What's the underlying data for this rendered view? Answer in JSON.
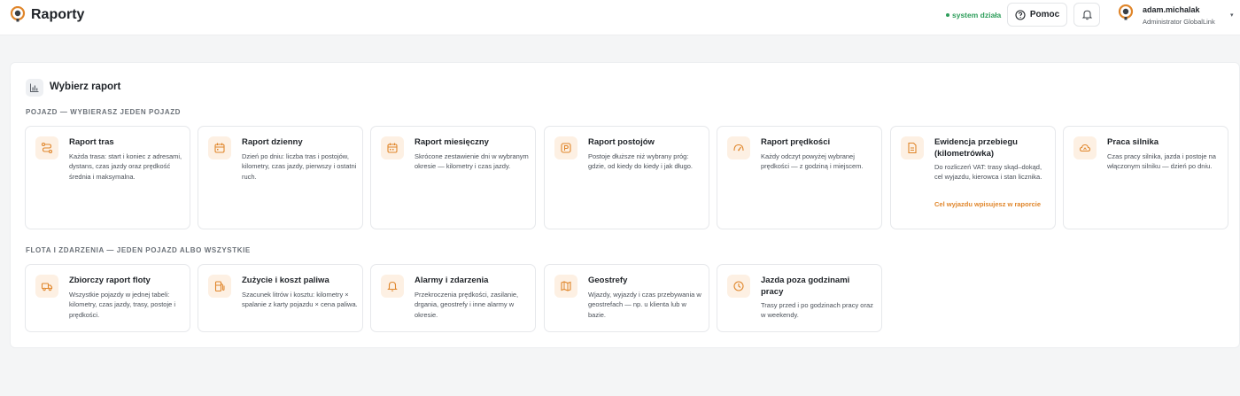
{
  "header": {
    "title": "Raporty",
    "status": "system działa",
    "help_label": "Pomoc",
    "user_name": "adam.michalak",
    "user_role": "Administrator GlobalLink"
  },
  "panel": {
    "title": "Wybierz raport",
    "sections": [
      {
        "label": "POJAZD — WYBIERASZ JEDEN POJAZD",
        "cards": [
          {
            "icon": "route-icon",
            "title": "Raport tras",
            "description": "Każda trasa: start i koniec z adresami, dystans, czas jazdy oraz prędkość średnia i maksymalna."
          },
          {
            "icon": "calendar-icon",
            "title": "Raport dzienny",
            "description": "Dzień po dniu: liczba tras i postojów, kilometry, czas jazdy, pierwszy i ostatni ruch."
          },
          {
            "icon": "calendar-icon",
            "title": "Raport miesięczny",
            "description": "Skrócone zestawienie dni w wybranym okresie — kilometry i czas jazdy."
          },
          {
            "icon": "parking-icon",
            "title": "Raport postojów",
            "description": "Postoje dłuższe niż wybrany próg: gdzie, od kiedy do kiedy i jak długo."
          },
          {
            "icon": "speedometer-icon",
            "title": "Raport prędkości",
            "description": "Każdy odczyt powyżej wybranej prędkości — z godziną i miejscem."
          },
          {
            "icon": "document-icon",
            "title": "Ewidencja przebiegu (kilometrówka)",
            "description": "Do rozliczeń VAT: trasy skąd–dokąd, cel wyjazdu, kierowca i stan licznika.",
            "note": "Cel wyjazdu wpisujesz w raporcie"
          },
          {
            "icon": "engine-icon",
            "title": "Praca silnika",
            "description": "Czas pracy silnika, jazda i postoje na włączonym silniku — dzień po dniu."
          }
        ]
      },
      {
        "label": "FLOTA I ZDARZENIA — JEDEN POJAZD ALBO WSZYSTKIE",
        "cards": [
          {
            "icon": "truck-icon",
            "title": "Zbiorczy raport floty",
            "description": "Wszystkie pojazdy w jednej tabeli: kilometry, czas jazdy, trasy, postoje i prędkości."
          },
          {
            "icon": "fuel-icon",
            "title": "Zużycie i koszt paliwa",
            "description": "Szacunek litrów i kosztu: kilometry × spalanie z karty pojazdu × cena paliwa."
          },
          {
            "icon": "bell-icon",
            "title": "Alarmy i zdarzenia",
            "description": "Przekroczenia prędkości, zasilanie, drgania, geostrefy i inne alarmy w okresie."
          },
          {
            "icon": "geofence-icon",
            "title": "Geostrefy",
            "description": "Wjazdy, wyjazdy i czas przebywania w geostrefach — np. u klienta lub w bazie."
          },
          {
            "icon": "clock-icon",
            "title": "Jazda poza godzinami pracy",
            "description": "Trasy przed i po godzinach pracy oraz w weekendy."
          }
        ]
      }
    ]
  },
  "colors": {
    "accent": "#e0862b",
    "icon_bg": "#fdf0e3",
    "status": "#2e9e5b"
  }
}
